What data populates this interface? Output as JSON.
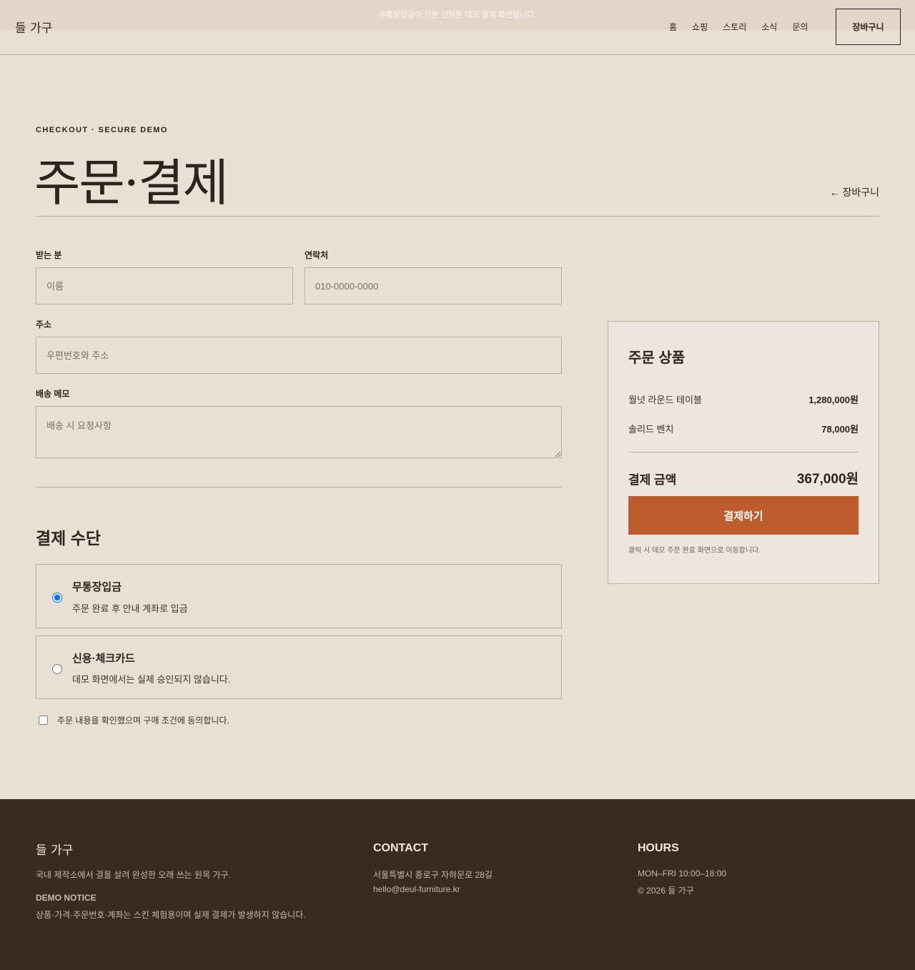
{
  "topbar": {
    "notice": "무통장입금이 기본 선택된 데모 결제 화면입니다."
  },
  "header": {
    "logo": "들 가구",
    "nav": [
      "홈",
      "쇼핑",
      "스토리",
      "소식",
      "문의"
    ],
    "cart_label": "장바구니"
  },
  "page": {
    "eyebrow": "CHECKOUT · SECURE DEMO",
    "title": "주문·결제",
    "back_link": "← 장바구니"
  },
  "form": {
    "name_label": "받는 분",
    "name_placeholder": "이름",
    "phone_label": "연락처",
    "phone_placeholder": "010-0000-0000",
    "address_label": "주소",
    "address_placeholder": "우편번호와 주소",
    "memo_label": "배송 메모",
    "memo_placeholder": "배송 시 요청사항"
  },
  "payment": {
    "title": "결제 수단",
    "options": [
      {
        "name": "무통장입금",
        "desc": "주문 완료 후 안내 계좌로 입금",
        "selected": true
      },
      {
        "name": "신용·체크카드",
        "desc": "데모 화면에서는 실제 승인되지 않습니다.",
        "selected": false
      }
    ],
    "agree": "주문 내용을 확인했으며 구매 조건에 동의합니다."
  },
  "summary": {
    "title": "주문 상품",
    "items": [
      {
        "name": "월넛 라운드 테이블",
        "price": "1,280,000원"
      },
      {
        "name": "솔리드 벤치",
        "price": "78,000원"
      }
    ],
    "total_label": "결제 금액",
    "total_value": "367,000원",
    "pay_button": "결제하기",
    "note": "클릭 시 데모 주문 완료 화면으로 이동합니다."
  },
  "footer": {
    "logo": "들 가구",
    "tagline": "국내 제작소에서 결을 살려 완성한 오래 쓰는 원목 가구.",
    "notice_title": "DEMO NOTICE",
    "notice_text": "상품·가격·주문번호·계좌는 스킨 체험용이며 실제 결제가 발생하지 않습니다.",
    "contact_title": "CONTACT",
    "address": "서울특별시 종로구 자하문로 28길",
    "email": "hello@deul-furniture.kr",
    "hours_title": "HOURS",
    "hours": "MON–FRI 10:00–18:00",
    "copyright": "© 2026 들 가구"
  },
  "colors": {
    "background": "#e8e0d5",
    "accent": "#bd5d2e",
    "footer": "#392a22",
    "text": "#2f241d"
  }
}
